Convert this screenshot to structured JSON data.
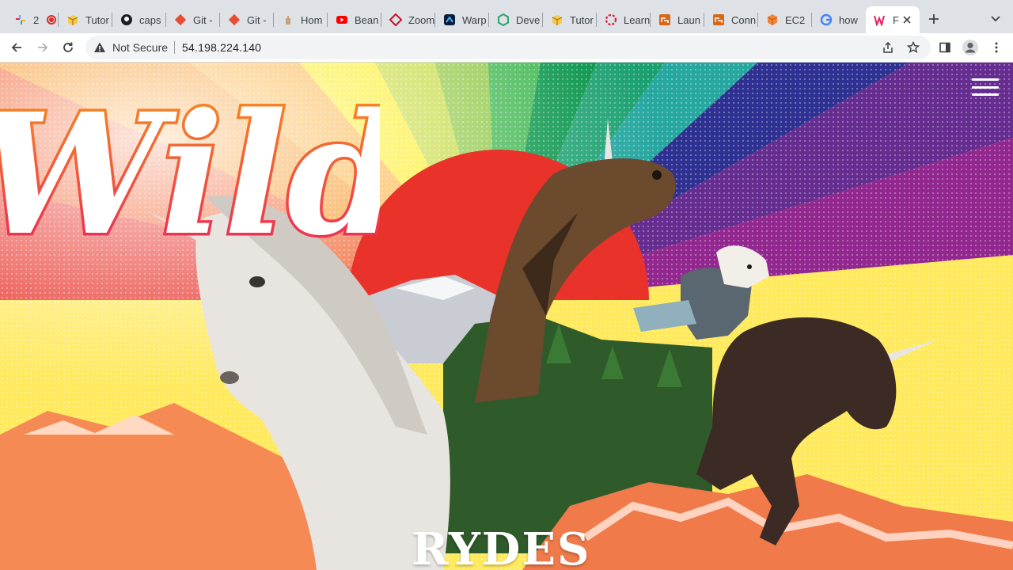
{
  "browser": {
    "tabs": [
      {
        "title": "2",
        "icon": "slack-icon"
      },
      {
        "title": "Tutor",
        "icon": "box-icon"
      },
      {
        "title": "caps",
        "icon": "github-icon"
      },
      {
        "title": "Git -",
        "icon": "git-icon"
      },
      {
        "title": "Git -",
        "icon": "git-icon"
      },
      {
        "title": "Hom",
        "icon": "hand-icon"
      },
      {
        "title": "Bean",
        "icon": "youtube-icon"
      },
      {
        "title": "Zoom",
        "icon": "diamond-icon"
      },
      {
        "title": "Warp",
        "icon": "warp-icon"
      },
      {
        "title": "Deve",
        "icon": "hex-icon"
      },
      {
        "title": "Tutor",
        "icon": "box-icon"
      },
      {
        "title": "Learn",
        "icon": "ring-icon"
      },
      {
        "title": "Laun",
        "icon": "aws-icon"
      },
      {
        "title": "Conn",
        "icon": "aws-icon"
      },
      {
        "title": "EC2",
        "icon": "cube-icon"
      },
      {
        "title": "how",
        "icon": "google-icon"
      },
      {
        "title": "F",
        "icon": "wild-rydes-icon"
      }
    ],
    "active_tab_index": 16,
    "security_label": "Not Secure",
    "url": "54.198.224.140"
  },
  "page": {
    "logo_wild": "Wild",
    "logo_rydes": "RYDES"
  },
  "colors": {
    "tabstrip": "#dee1e6",
    "rainbow": [
      "#e8322a",
      "#f15a24",
      "#f7931e",
      "#fbb03b",
      "#fcee21",
      "#c4d93a",
      "#8cc63f",
      "#39b54a",
      "#009245",
      "#1aa06f",
      "#26a7a0",
      "#2e3192",
      "#662d91",
      "#92278f"
    ],
    "ground": "#f58a55"
  }
}
